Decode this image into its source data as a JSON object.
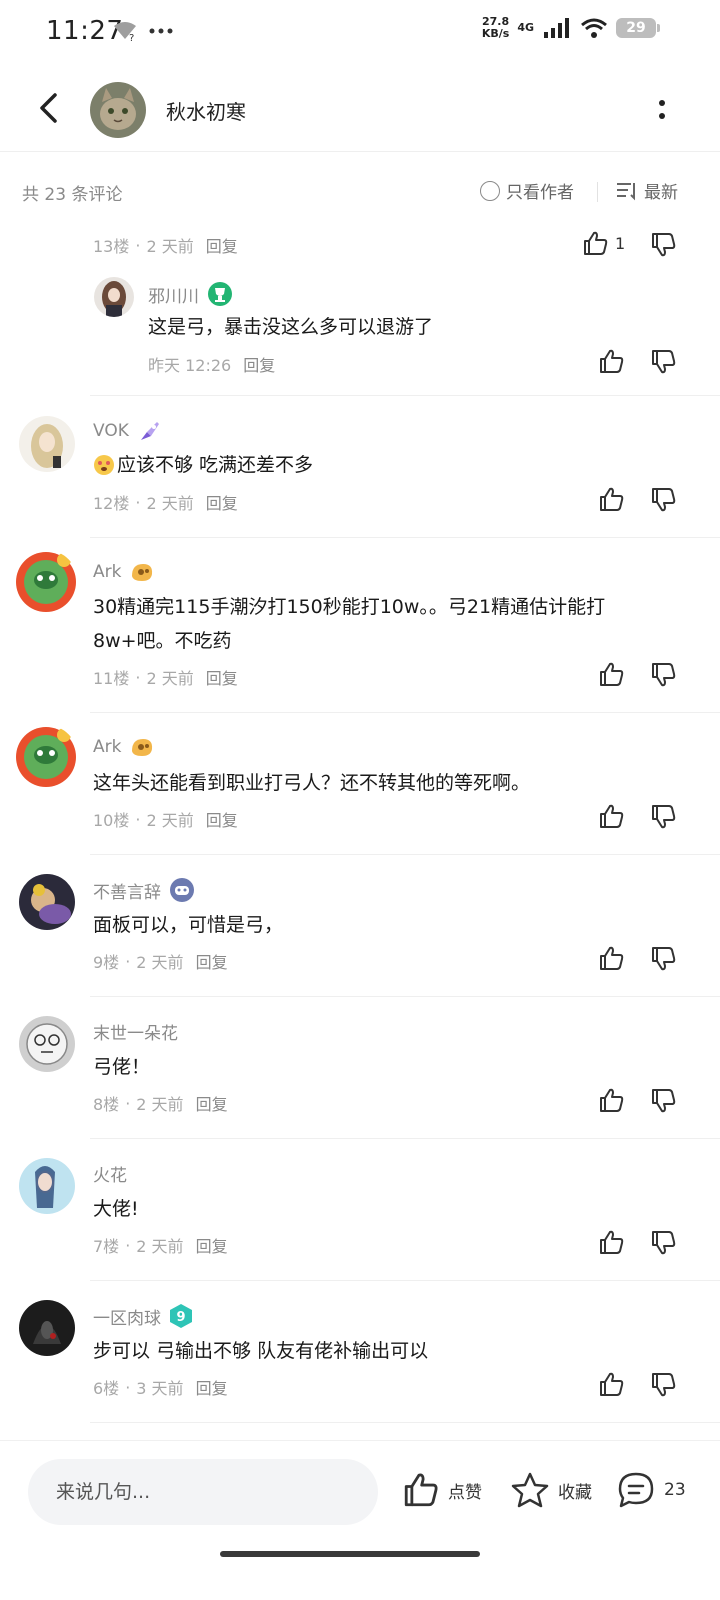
{
  "status_bar": {
    "time": "11:27",
    "speed_value": "27.8",
    "speed_unit": "KB/s",
    "network": "4G",
    "battery": "29"
  },
  "header": {
    "author_name": "秋水初寒"
  },
  "toolbar": {
    "comment_count": "共 23 条评论",
    "author_only": "只看作者",
    "sort": "最新"
  },
  "comments": [
    {
      "floor": "13楼",
      "time": "2 天前",
      "reply": "回复",
      "likes": "1"
    },
    {
      "name": "邪川川",
      "text": "这是弓，暴击没这么多可以退游了",
      "time": "昨天 12:26",
      "reply": "回复"
    },
    {
      "name": "VOK",
      "text": "应该不够 吃满还差不多",
      "emoji": "emoji-face",
      "floor": "12楼",
      "time": "2 天前",
      "reply": "回复"
    },
    {
      "name": "Ark",
      "text_line1": "30精通完115手潮汐打150秒能打10w。。弓21精通估计能打",
      "text_line2": "8w+吧。不吃药",
      "floor": "11楼",
      "time": "2 天前",
      "reply": "回复"
    },
    {
      "name": "Ark",
      "text": "这年头还能看到职业打弓人？还不转其他的等死啊。",
      "floor": "10楼",
      "time": "2 天前",
      "reply": "回复"
    },
    {
      "name": "不善言辞",
      "text": "面板可以，可惜是弓，",
      "floor": "9楼",
      "time": "2 天前",
      "reply": "回复"
    },
    {
      "name": "末世一朵花",
      "text": "弓佬！",
      "floor": "8楼",
      "time": "2 天前",
      "reply": "回复"
    },
    {
      "name": "火花",
      "text": "大佬!",
      "floor": "7楼",
      "time": "2 天前",
      "reply": "回复"
    },
    {
      "name": "一区肉球",
      "text": "步可以 弓输出不够 队友有佬补输出可以",
      "floor": "6楼",
      "time": "3 天前",
      "reply": "回复"
    }
  ],
  "bottom_bar": {
    "input_placeholder": "来说几句...",
    "like_label": "点赞",
    "favorite_label": "收藏",
    "comment_count": "23"
  },
  "colors": {
    "verified_green": "#22b573",
    "level_teal": "#2ec4b6",
    "text_gray": "#8a8a8a"
  }
}
